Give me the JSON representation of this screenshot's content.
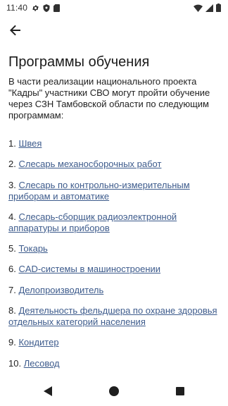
{
  "status_bar": {
    "time": "11:40",
    "icons_left": [
      "gear-icon",
      "shield-icon",
      "sd-card-icon"
    ],
    "icons_right": [
      "wifi-icon",
      "signal-icon",
      "battery-icon"
    ]
  },
  "app_bar": {
    "back_icon": "arrow-left-icon"
  },
  "page": {
    "title": "Программы обучения",
    "intro": "В части реализации национального проекта \"Кадры\" участники СВО могут пройти обучение через СЗН Тамбовской области по следующим программам:",
    "programs": [
      {
        "number": "1.",
        "label": "Швея"
      },
      {
        "number": "2.",
        "label": "Слесарь механосборочных работ"
      },
      {
        "number": "3.",
        "label": "Слесарь по контрольно-измерительным приборам и автоматике"
      },
      {
        "number": "4.",
        "label": "Слесарь-сборщик радиоэлектронной аппаратуры и приборов"
      },
      {
        "number": "5.",
        "label": "Токарь"
      },
      {
        "number": "6.",
        "label": "CAD-системы в машиностроении"
      },
      {
        "number": "7.",
        "label": "Делопроизводитель"
      },
      {
        "number": "8.",
        "label": "Деятельность фельдшера по охране здоровья отдельных категорий населения"
      },
      {
        "number": "9.",
        "label": "Кондитер"
      },
      {
        "number": "10.",
        "label": "Лесовод"
      }
    ]
  },
  "nav_bar": {
    "icons": [
      "back-triangle-icon",
      "home-circle-icon",
      "recents-square-icon"
    ]
  },
  "colors": {
    "link": "#3d5b8c",
    "text": "#222222",
    "background": "#ffffff"
  }
}
